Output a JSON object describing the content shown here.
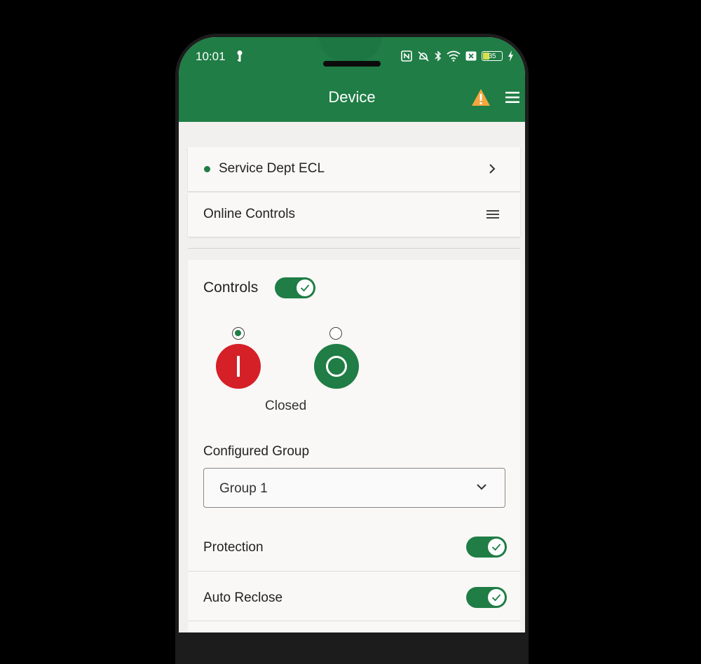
{
  "status_bar": {
    "time": "10:01",
    "battery": "35"
  },
  "app_bar": {
    "title": "Device",
    "warning_icon": "warning-triangle-icon",
    "menu_icon": "hamburger-menu-icon",
    "color": "#1f7d45"
  },
  "device": {
    "name": "Service Dept ECL",
    "status_color": "#1f7d45"
  },
  "section": {
    "label": "Online Controls"
  },
  "controls": {
    "label": "Controls",
    "enabled": true,
    "close_button_color": "#d52027",
    "open_button_color": "#1f7d45",
    "selected": "close",
    "state_text": "Closed"
  },
  "group": {
    "label": "Configured Group",
    "selected": "Group 1"
  },
  "settings": [
    {
      "label": "Protection",
      "enabled": true
    },
    {
      "label": "Auto Reclose",
      "enabled": true
    }
  ]
}
